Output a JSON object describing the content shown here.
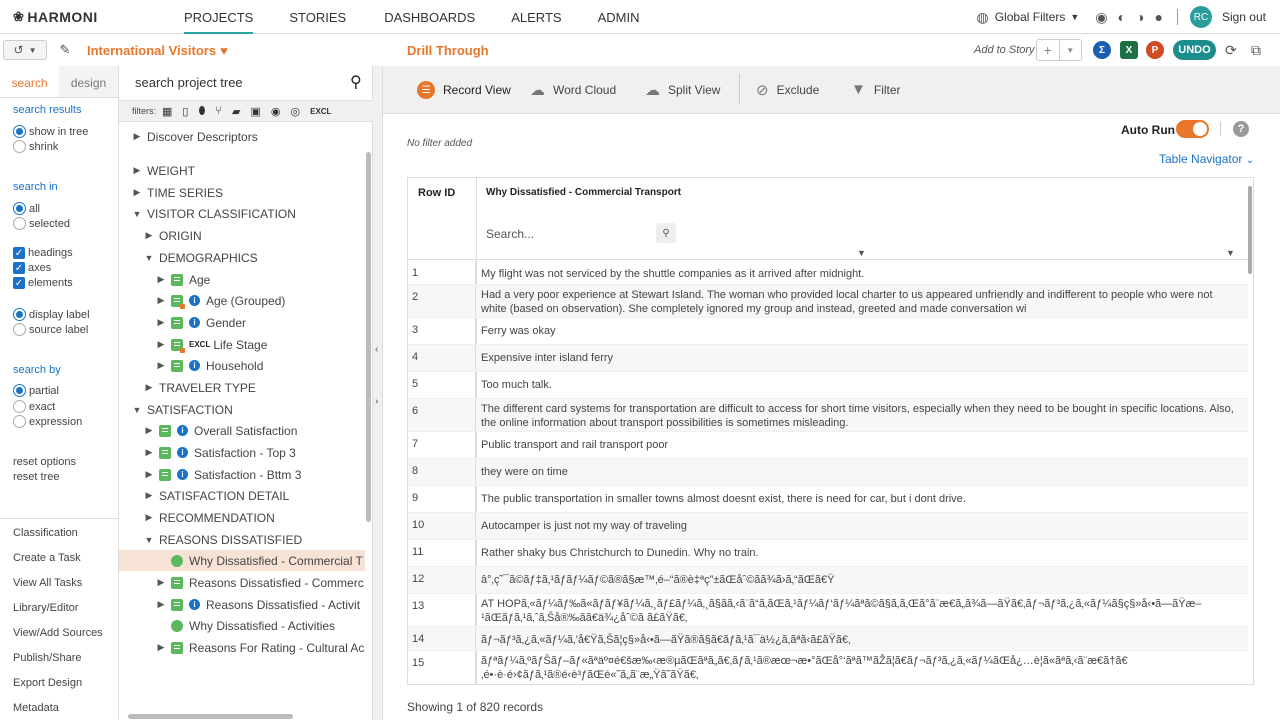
{
  "app": {
    "logo": "HARMONI"
  },
  "nav": {
    "items": [
      "PROJECTS",
      "STORIES",
      "DASHBOARDS",
      "ALERTS",
      "ADMIN"
    ],
    "active": "PROJECTS",
    "global_filters": "Global Filters",
    "avatar": "RC",
    "sign_out": "Sign out"
  },
  "project": {
    "name": "International Visitors"
  },
  "view": {
    "title": "Drill Through",
    "add_to_story": "Add to Story",
    "undo": "UNDO"
  },
  "left_tabs": [
    "search",
    "design"
  ],
  "search_panel": {
    "results_label": "search results",
    "show_in_tree": "show in tree",
    "shrink": "shrink",
    "search_in_label": "search in",
    "all": "all",
    "selected": "selected",
    "headings": "headings",
    "axes": "axes",
    "elements": "elements",
    "display_label": "display label",
    "source_label": "source label",
    "search_by_label": "search by",
    "partial": "partial",
    "exact": "exact",
    "expression": "expression",
    "reset_options": "reset options",
    "reset_tree": "reset tree"
  },
  "left_links": [
    "Classification",
    "Create a Task",
    "View All Tasks",
    "Library/Editor",
    "View/Add Sources",
    "Publish/Share",
    "Export Design",
    "Metadata"
  ],
  "tree_search": {
    "placeholder": "search project tree"
  },
  "filters_label": "filters:",
  "tree": [
    {
      "label": "Discover Descriptors",
      "depth": 0,
      "arrow": "right",
      "icon": ""
    },
    {
      "label": "WEIGHT",
      "depth": 0,
      "arrow": "right",
      "icon": ""
    },
    {
      "label": "TIME SERIES",
      "depth": 0,
      "arrow": "right",
      "icon": ""
    },
    {
      "label": "VISITOR CLASSIFICATION",
      "depth": 0,
      "arrow": "down",
      "icon": ""
    },
    {
      "label": "ORIGIN",
      "depth": 1,
      "arrow": "right",
      "icon": ""
    },
    {
      "label": "DEMOGRAPHICS",
      "depth": 1,
      "arrow": "down",
      "icon": ""
    },
    {
      "label": "Age",
      "depth": 2,
      "arrow": "right",
      "icon": "doc"
    },
    {
      "label": "Age (Grouped)",
      "depth": 2,
      "arrow": "right",
      "icon": "doc-orange-info"
    },
    {
      "label": "Gender",
      "depth": 2,
      "arrow": "right",
      "icon": "doc-info"
    },
    {
      "label": "Life Stage",
      "depth": 2,
      "arrow": "right",
      "icon": "doc-orange-excl"
    },
    {
      "label": "Household",
      "depth": 2,
      "arrow": "right",
      "icon": "doc-info"
    },
    {
      "label": "TRAVELER TYPE",
      "depth": 1,
      "arrow": "right",
      "icon": ""
    },
    {
      "label": "SATISFACTION",
      "depth": 0,
      "arrow": "down",
      "icon": ""
    },
    {
      "label": "Overall Satisfaction",
      "depth": 1,
      "arrow": "right",
      "icon": "doc-info"
    },
    {
      "label": "Satisfaction - Top 3",
      "depth": 1,
      "arrow": "right",
      "icon": "doc-info"
    },
    {
      "label": "Satisfaction - Bttm 3",
      "depth": 1,
      "arrow": "right",
      "icon": "doc-info"
    },
    {
      "label": "SATISFACTION DETAIL",
      "depth": 1,
      "arrow": "right",
      "icon": ""
    },
    {
      "label": "RECOMMENDATION",
      "depth": 1,
      "arrow": "right",
      "icon": ""
    },
    {
      "label": "REASONS DISSATISFIED",
      "depth": 1,
      "arrow": "down",
      "icon": ""
    },
    {
      "label": "Why Dissatisfied - Commercial T",
      "depth": 2,
      "arrow": "none",
      "icon": "bubble",
      "selected": true
    },
    {
      "label": "Reasons Dissatisfied - Commerc",
      "depth": 2,
      "arrow": "right",
      "icon": "doc"
    },
    {
      "label": "Reasons Dissatisfied - Activit",
      "depth": 2,
      "arrow": "right",
      "icon": "doc-info"
    },
    {
      "label": "Why Dissatisfied - Activities",
      "depth": 2,
      "arrow": "none",
      "icon": "bubble"
    },
    {
      "label": "Reasons For Rating - Cultural Ac",
      "depth": 2,
      "arrow": "right",
      "icon": "doc"
    }
  ],
  "toolbar": {
    "record_view": "Record View",
    "word_cloud": "Word Cloud",
    "split_view": "Split View",
    "exclude": "Exclude",
    "filter": "Filter"
  },
  "no_filter": "No filter added",
  "auto_run": "Auto Run",
  "table_navigator": "Table Navigator",
  "table": {
    "col_id": "Row ID",
    "col_text": "Why Dissatisfied - Commercial Transport",
    "search_placeholder": "Search...",
    "rows": [
      {
        "id": "1",
        "text": "My flight was not serviced by the shuttle companies as it arrived after midnight."
      },
      {
        "id": "2",
        "text": "Had a very poor experience at Stewart Island. The woman who provided local charter to us appeared unfriendly and indifferent to people who were not white (based on observation). She completely ignored my group and instead, greeted and made conversation wi"
      },
      {
        "id": "3",
        "text": "Ferry was okay"
      },
      {
        "id": "4",
        "text": "Expensive inter island ferry"
      },
      {
        "id": "5",
        "text": "Too much talk."
      },
      {
        "id": "6",
        "text": "The different card systems for transportation are difficult to access for short time visitors, especially when they need to be bought in specific locations. Also, the online information about transport possibilities is sometimes misleading."
      },
      {
        "id": "7",
        "text": "Public transport and rail transport poor"
      },
      {
        "id": "8",
        "text": "they were on time"
      },
      {
        "id": "9",
        "text": "The public transportation in smaller towns almost doesnt exist, there is need for car, but i dont drive."
      },
      {
        "id": "10",
        "text": "Autocamper is just not my way of traveling"
      },
      {
        "id": "11",
        "text": "Rather shaky bus Christchurch to Dunedin. Why no train."
      },
      {
        "id": "12",
        "text": "â°‚ç˜¯ã©ãƒ‡ã‚¹ãƒ­ãƒ¼ãƒ©ã®ã§æ™‚é–“ã®è‡ªç”±ãŒåˆ©ãã¾ã›ã‚“ãŒã€Ÿ"
      },
      {
        "id": "13",
        "text": "AT HOPã‚«ãƒ¼ãƒ‰ã«ãƒãƒ¥ãƒ¼ã‚¸ãƒ£ãƒ¼ã‚¸ã§ãã‚‹ã¨ã“ã‚ãŒã‚¹ãƒ¼ãƒ‘ãƒ¼ãªã©ã§ã‚ã‚Œã°ã¨æ€ã„ã¾ã—ãŸã€‚ãƒ¬ãƒ³ã‚¿ã‚«ãƒ¼ã§ç§»å‹•ã—ãŸæ–¹ãŒãƒã‚¹ã‚ˆã‚Šå®‰ãã€ä¾¿åˆ©ã ã£ãŸã€‚"
      },
      {
        "id": "14",
        "text": "ãƒ¬ãƒ³ã‚¿ã‚«ãƒ¼ã‚’å€Ÿã‚Šã¦ç§»å‹•ã—ãŸã®ã§ã€ãƒã‚¹ã¯ä½¿ã‚ãªã‹ã£ãŸã€‚"
      },
      {
        "id": "15",
        "text": "ãƒªãƒ¼ã‚ºãƒŠãƒ–ãƒ«ãªäº¤é€šæ‰‹æ®µãŒãªã„ã€‚ãƒã‚¹ã®æœ¬æ•°ãŒå°‘ãªã™ãŽã¦ã€ãƒ¬ãƒ³ã‚¿ã‚«ãƒ¼ãŒå¿…è¦ã«ãªã‚‹ã¨æ€ã†ã€‚é•·è·é›¢ãƒã‚¹ã®é‹è³ƒãŒé«˜ã„ã¨æ„Ÿã˜ãŸã€‚"
      }
    ]
  },
  "footer": "Showing 1 of 820 records",
  "colors": {
    "accent": "#e8762b",
    "teal": "#1c8d8d",
    "link": "#1a73c7"
  }
}
